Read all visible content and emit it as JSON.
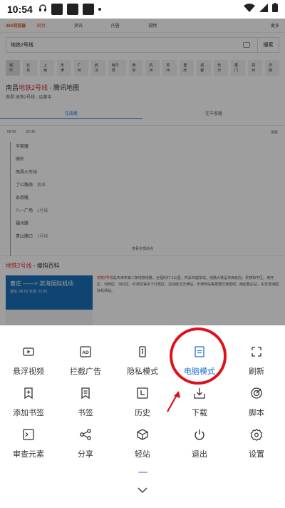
{
  "status_bar": {
    "time": "10:54"
  },
  "page": {
    "logo": "360浏览器",
    "tabs": [
      "网页",
      "资讯",
      "问答",
      "视频",
      "更多"
    ],
    "search_query": "地铁2号线",
    "search_button": "搜索",
    "cities": [
      "城市",
      "北京",
      "上海",
      "天津",
      "广州",
      "武汉",
      "哈尔滨",
      "南京",
      "杭州",
      "苏州",
      "重庆",
      "成都",
      "长沙",
      "厦门",
      "郑州",
      "济南"
    ],
    "map_title_prefix": "南昌",
    "map_title_red": "地铁2号线",
    "map_title_suffix": " - 腾讯地图",
    "map_sub": "南昌 地铁2号线 · 运营中",
    "directions": [
      "往南路",
      "往辛家庵"
    ],
    "times": {
      "first": "06:00",
      "last": "22:30",
      "more": "地铁"
    },
    "stations": [
      {
        "name": "辛家庵",
        "tag": ""
      },
      {
        "name": "顺外",
        "tag": ""
      },
      {
        "name": "南昌火车站",
        "tag": ""
      },
      {
        "name": "丁公路南",
        "tag": "换乘"
      },
      {
        "name": "永叔路",
        "tag": ""
      },
      {
        "name": "八一广场",
        "tag": "1号线"
      },
      {
        "name": "福州路",
        "tag": ""
      },
      {
        "name": "青山路口",
        "tag": "1号线"
      }
    ],
    "show_all": "查看全部站点",
    "baike_title_red": "地铁2号线",
    "baike_title_suffix": " - 搜狗百科",
    "baike_img_title": "曹庄 ——> 滨海国际机场",
    "baike_img_sub": "首班: 06:00  末班: 22:30",
    "baike_text_red": "地铁2号线",
    "baike_text": "是天津市第二条地铁线路，全程约27.1公里，共设20座车站，线路大致呈东西走向，贯穿和平区、南开区、河西区、河北区、红桥区等多个行政区，沿线经过天津站、天津西站等重要交通枢纽，西起曹庄站，东至滨海国际机场站。"
  },
  "menu": {
    "items": [
      {
        "label": "悬浮视频",
        "icon": "floating-video-icon"
      },
      {
        "label": "拦截广告",
        "icon": "ad-block-icon"
      },
      {
        "label": "隐私模式",
        "icon": "privacy-mode-icon"
      },
      {
        "label": "电脑模式",
        "icon": "desktop-mode-icon"
      },
      {
        "label": "刷新",
        "icon": "refresh-icon"
      },
      {
        "label": "添加书签",
        "icon": "add-bookmark-icon"
      },
      {
        "label": "书签",
        "icon": "bookmarks-icon"
      },
      {
        "label": "历史",
        "icon": "history-icon"
      },
      {
        "label": "下载",
        "icon": "download-icon"
      },
      {
        "label": "脚本",
        "icon": "script-icon"
      },
      {
        "label": "审查元素",
        "icon": "inspect-element-icon"
      },
      {
        "label": "分享",
        "icon": "share-icon"
      },
      {
        "label": "轻站",
        "icon": "light-site-icon"
      },
      {
        "label": "退出",
        "icon": "exit-icon"
      },
      {
        "label": "设置",
        "icon": "settings-icon"
      }
    ],
    "highlighted": "电脑模式",
    "accent_color": "#1e6fd9",
    "annotation_color": "#e0101a"
  }
}
